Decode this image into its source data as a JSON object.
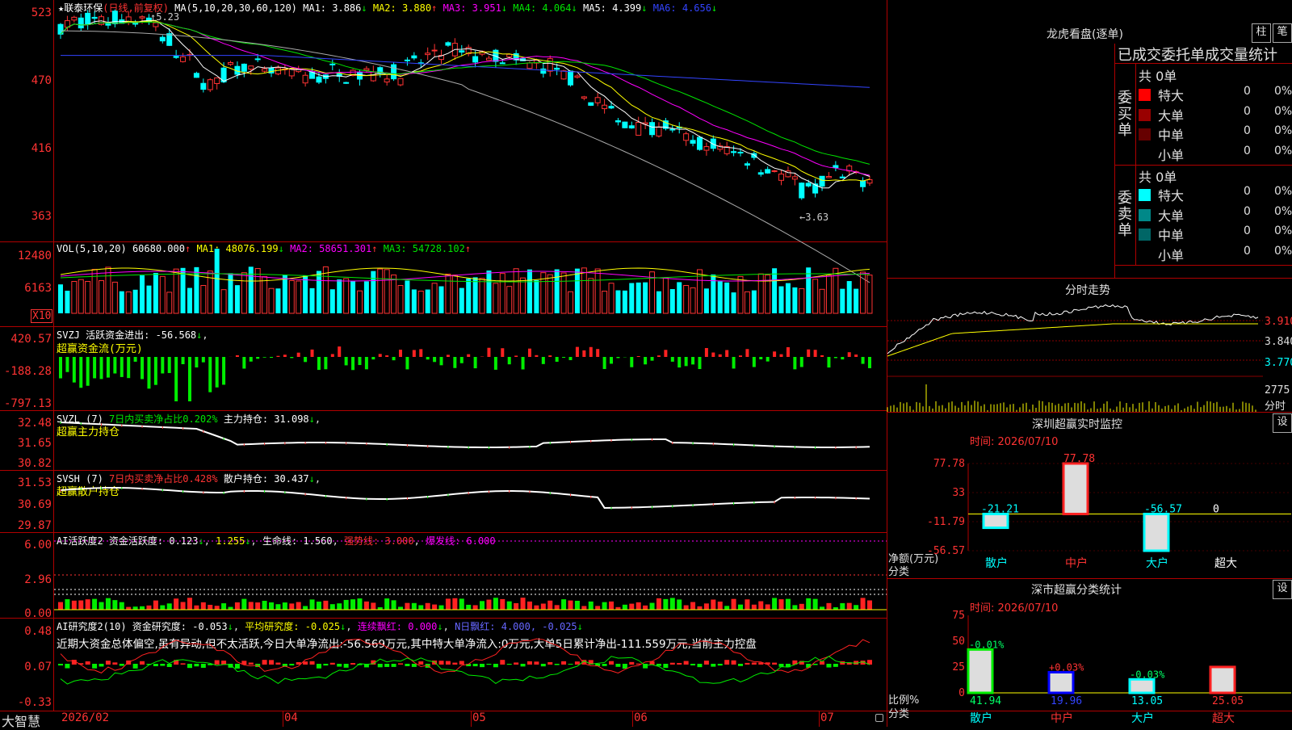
{
  "stock": {
    "star": "★",
    "name": "联泰环保",
    "period": "(日线,前复权)"
  },
  "price_panel": {
    "ma_label": "MA(5,10,20,30,60,120)",
    "ma1": "MA1: 3.886",
    "ma2": "MA2: 3.880",
    "ma3": "MA3: 3.951",
    "ma4": "MA4: 4.064",
    "ma5": "MA5: 4.399",
    "ma6": "MA6: 4.656",
    "axis": [
      "523",
      "470",
      "416",
      "363"
    ],
    "high_label": "5.23",
    "low_label": "3.63"
  },
  "vol_panel": {
    "title": "VOL(5,10,20)",
    "value": "60680.000",
    "ma1": "MA1: 48076.199",
    "ma2": "MA2: 58651.301",
    "ma3": "MA3: 54728.102",
    "axis": [
      "12480",
      "6163"
    ],
    "unit": "X10"
  },
  "svzj_panel": {
    "title": "SVZJ  活跃资金进出: -56.568",
    "subtitle": "超赢资金流(万元)",
    "axis": [
      "420.57",
      "-188.28",
      "-797.13"
    ]
  },
  "svzl_panel": {
    "title": "SVZL (7)",
    "ratio": "7日内买卖净占比0.202%",
    "hold": "主力持仓: 31.098",
    "subtitle": "超赢主力持仓",
    "axis": [
      "32.48",
      "31.65",
      "30.82"
    ]
  },
  "svsh_panel": {
    "title": "SVSH (7)",
    "ratio": "7日内买卖净占比0.428%",
    "hold": "散户持仓: 30.437",
    "subtitle": "超赢散户持仓",
    "axis": [
      "31.53",
      "30.69",
      "29.87"
    ]
  },
  "ai_active_panel": {
    "title": "AI活跃度2 资金活跃度: 0.123",
    "v2": "1.255",
    "life": "生命线: 1.560",
    "strong": "强势线: 3.000",
    "burst": "爆发线: 6.000",
    "axis": [
      "6.00",
      "2.96",
      "0.00"
    ]
  },
  "ai_research_panel": {
    "title": "AI研究度2(10) 资金研究度: -0.053",
    "avg": "平均研究度: -0.025",
    "streak": "连续飘红: 0.000",
    "nday": "N日飘红: 4.000, -0.025",
    "note": "近期大资金总体偏空,虽有异动,但不太活跃,今日大单净流出:-56.569万元,其中特大单净流入:0万元,大单5日累计净出-111.559万元,当前主力控盘",
    "axis": [
      "0.48",
      "0.07",
      "-0.33"
    ]
  },
  "bottom_axis": {
    "brand": "大智慧",
    "labels": [
      "2026/02",
      "04",
      "05",
      "06",
      "07"
    ]
  },
  "dragon_tiger": {
    "title": "龙虎看盘(逐单)",
    "btn1": "柱",
    "btn2": "笔",
    "header": "已成交委托单成交量统计",
    "buy": {
      "label": "委买单",
      "total": "共 0单",
      "rows": [
        {
          "name": "特大",
          "qty": "0",
          "pct": "0%",
          "color": "#ff0000"
        },
        {
          "name": "大单",
          "qty": "0",
          "pct": "0%",
          "color": "#990000"
        },
        {
          "name": "中单",
          "qty": "0",
          "pct": "0%",
          "color": "#660000"
        },
        {
          "name": "小单",
          "qty": "0",
          "pct": "0%",
          "color": ""
        }
      ]
    },
    "sell": {
      "label": "委卖单",
      "total": "共 0单",
      "rows": [
        {
          "name": "特大",
          "qty": "0",
          "pct": "0%",
          "color": "#00ffff"
        },
        {
          "name": "大单",
          "qty": "0",
          "pct": "0%",
          "color": "#008888"
        },
        {
          "name": "中单",
          "qty": "0",
          "pct": "0%",
          "color": "#006666"
        },
        {
          "name": "小单",
          "qty": "0",
          "pct": "0%",
          "color": ""
        }
      ]
    }
  },
  "intraday": {
    "title": "分时走势",
    "axis": [
      "3.910",
      "3.840",
      "3.770"
    ],
    "vol": "2775",
    "vol_unit": "分时"
  },
  "sz_monitor": {
    "title": "深圳超赢实时监控",
    "btn": "设",
    "time": "时间: 2026/07/10",
    "axis": [
      "77.78",
      "33",
      "-11.79",
      "-56.57"
    ],
    "ylabel": "净额(万元)",
    "xlabel": "分类",
    "categories": [
      "散户",
      "中户",
      "大户",
      "超大"
    ],
    "values": [
      "-21.21",
      "77.78",
      "-56.57",
      "0"
    ]
  },
  "sz_classify": {
    "title": "深市超赢分类统计",
    "btn": "设",
    "time": "时间: 2026/07/10",
    "axis": [
      "75",
      "50",
      "25",
      "0"
    ],
    "ylabel": "比例%",
    "xlabel": "分类",
    "categories": [
      "散户",
      "中户",
      "大户",
      "超大"
    ],
    "values": [
      "41.94",
      "19.96",
      "13.05",
      "25.05"
    ],
    "changes": [
      "-0.01%",
      "+0.03%",
      "-0.03%",
      ""
    ]
  },
  "chart_data": [
    {
      "type": "bar",
      "title": "深圳超赢实时监控",
      "categories": [
        "散户",
        "中户",
        "大户",
        "超大"
      ],
      "values": [
        -21.21,
        77.78,
        -56.57,
        0
      ],
      "ylabel": "净额(万元)",
      "ylim": [
        -56.57,
        77.78
      ]
    },
    {
      "type": "bar",
      "title": "深市超赢分类统计",
      "categories": [
        "散户",
        "中户",
        "大户",
        "超大"
      ],
      "values": [
        41.94,
        19.96,
        13.05,
        25.05
      ],
      "ylabel": "比例%",
      "ylim": [
        0,
        75
      ]
    }
  ]
}
